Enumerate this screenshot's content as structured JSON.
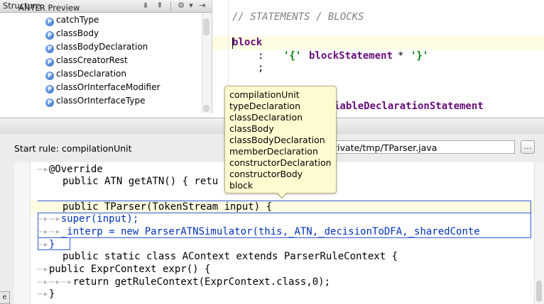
{
  "structure": {
    "title": "Structure",
    "toolbar_icons": [
      "collapse-all-icon",
      "expand-all-icon",
      "gear-icon",
      "hide-icon"
    ],
    "items": [
      {
        "label": "catchType",
        "icon": "P"
      },
      {
        "label": "classBody",
        "icon": "P"
      },
      {
        "label": "classBodyDeclaration",
        "icon": "P"
      },
      {
        "label": "classCreatorRest",
        "icon": "P"
      },
      {
        "label": "classDeclaration",
        "icon": "P"
      },
      {
        "label": "classOrInterfaceModifier",
        "icon": "P"
      },
      {
        "label": "classOrInterfaceType",
        "icon": "P"
      }
    ]
  },
  "grammar": {
    "comment": "// STATEMENTS / BLOCKS",
    "rule_name": "block",
    "colon": ":",
    "literal_open": "'{'",
    "rule_ref": "blockStatement",
    "star": "*",
    "literal_close": "'}'",
    "semicolon": ";",
    "partial_line": "iableDeclarationStatement"
  },
  "preview": {
    "title": "ANTLR Preview",
    "start_rule_label": "Start rule: compilationUnit",
    "file_path": "rivate/tmp/TParser.java",
    "browse_label": "...",
    "side_tab": "e",
    "code_lines": [
      "@Override",
      "public ATN getATN() { retu",
      "",
      "public TParser(TokenStream input) {",
      "super(input);",
      "_interp = new ParserATNSimulator(this,_ATN,_decisionToDFA,_sharedConte",
      "}",
      "public static class AContext extends ParserRuleContext {",
      "public ExprContext expr() {",
      "return getRuleContext(ExprContext.class,0);",
      "}"
    ]
  },
  "completion": {
    "items": [
      "compilationUnit",
      "typeDeclaration",
      "classDeclaration",
      "classBody",
      "classBodyDeclaration",
      "memberDeclaration",
      "constructorDeclaration",
      "constructorBody",
      "block"
    ]
  },
  "colors": {
    "rule_purple": "#660e7a",
    "literal_green": "#008000",
    "comment_gray": "#808080",
    "highlight_blue": "#2f5bd8",
    "popup_yellow": "#fffbd0",
    "current_line": "#fdfbe2"
  }
}
